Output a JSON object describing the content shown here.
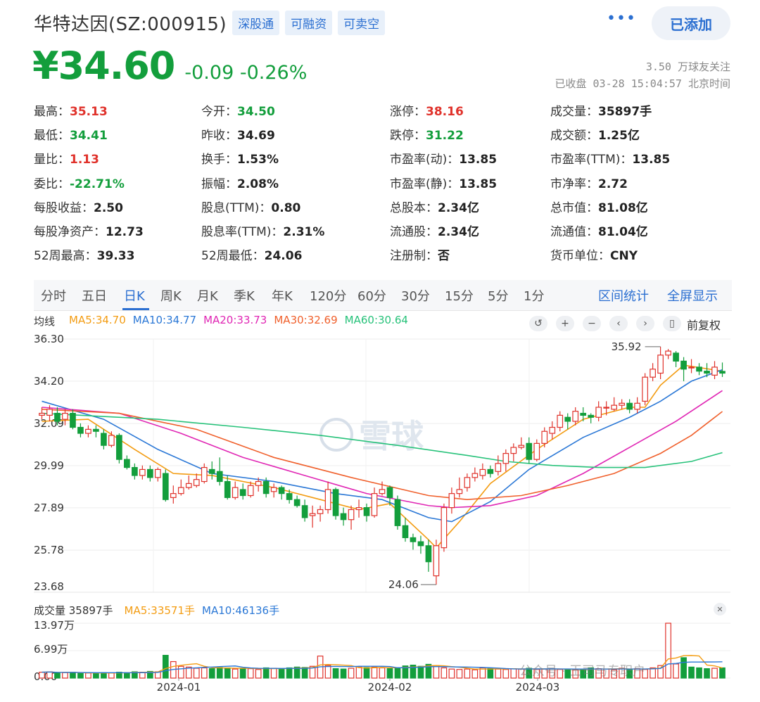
{
  "header": {
    "title": "华特达因(SZ:000915)",
    "tags": [
      "深股通",
      "可融资",
      "可卖空"
    ],
    "more_icon": "more-horizontal-icon",
    "added_label": "已添加"
  },
  "price": {
    "value": "¥34.60",
    "change": "-0.09 -0.26%",
    "followers": "3.50 万球友关注",
    "status": "已收盘 03-28 15:04:57 北京时间"
  },
  "quotes": [
    [
      [
        "最高：",
        "35.13",
        "red"
      ],
      [
        "今开：",
        "34.50",
        "green"
      ],
      [
        "涨停：",
        "38.16",
        "red"
      ],
      [
        "成交量：",
        "35897手",
        ""
      ]
    ],
    [
      [
        "最低：",
        "34.41",
        "green"
      ],
      [
        "昨收：",
        "34.69",
        ""
      ],
      [
        "跌停：",
        "31.22",
        "green"
      ],
      [
        "成交额：",
        "1.25亿",
        ""
      ]
    ],
    [
      [
        "量比：",
        "1.13",
        "red"
      ],
      [
        "换手：",
        "1.53%",
        ""
      ],
      [
        "市盈率(动)：",
        "13.85",
        ""
      ],
      [
        "市盈率(TTM)：",
        "13.85",
        ""
      ]
    ],
    [
      [
        "委比：",
        "-22.71%",
        "green"
      ],
      [
        "振幅：",
        "2.08%",
        ""
      ],
      [
        "市盈率(静)：",
        "13.85",
        ""
      ],
      [
        "市净率：",
        "2.72",
        ""
      ]
    ],
    [
      [
        "每股收益：",
        "2.50",
        ""
      ],
      [
        "股息(TTM)：",
        "0.80",
        ""
      ],
      [
        "总股本：",
        "2.34亿",
        ""
      ],
      [
        "总市值：",
        "81.08亿",
        ""
      ]
    ],
    [
      [
        "每股净资产：",
        "12.73",
        ""
      ],
      [
        "股息率(TTM)：",
        "2.31%",
        ""
      ],
      [
        "流通股：",
        "2.34亿",
        ""
      ],
      [
        "流通值：",
        "81.04亿",
        ""
      ]
    ],
    [
      [
        "52周最高：",
        "39.33",
        ""
      ],
      [
        "52周最低：",
        "24.06",
        ""
      ],
      [
        "注册制：",
        "否",
        ""
      ],
      [
        "货币单位：",
        "CNY",
        ""
      ]
    ]
  ],
  "tabs": [
    "分时",
    "五日",
    "日K",
    "周K",
    "月K",
    "季K",
    "年K",
    "120分",
    "60分",
    "30分",
    "15分",
    "5分",
    "1分"
  ],
  "active_tab": "日K",
  "tab_actions": [
    "区间统计",
    "全屏显示"
  ],
  "ma_legend": {
    "label": "均线",
    "items": [
      {
        "text": "MA5:34.70",
        "color": "#f39c12"
      },
      {
        "text": "MA10:34.77",
        "color": "#2b78d6"
      },
      {
        "text": "MA20:33.73",
        "color": "#e026b4"
      },
      {
        "text": "MA30:32.69",
        "color": "#f0602c"
      },
      {
        "text": "MA60:30.64",
        "color": "#27c27a"
      }
    ]
  },
  "tools": [
    "↺",
    "+",
    "−",
    "‹",
    "›",
    "▯"
  ],
  "tool_icons": [
    "undo-icon",
    "zoom-in-icon",
    "zoom-out-icon",
    "chevron-left-icon",
    "chevron-right-icon",
    "candle-icon"
  ],
  "adjust_label": "前复权",
  "watermark": "雪球",
  "watermark_icon": "snowball-logo-icon",
  "chart_data": {
    "type": "candlestick",
    "y_ticks": [
      "36.30",
      "34.20",
      "32.09",
      "29.99",
      "27.89",
      "25.78",
      "23.68"
    ],
    "ylim": [
      23.68,
      36.3
    ],
    "x_ticks": [
      "2024-01",
      "2024-02",
      "2024-03"
    ],
    "max_label": "35.92",
    "min_label": "24.06",
    "candles": [
      [
        32.5,
        32.6,
        32.9,
        32.3
      ],
      [
        32.5,
        32.8,
        33.0,
        32.2
      ],
      [
        32.6,
        32.2,
        32.9,
        32.0
      ],
      [
        32.3,
        32.6,
        32.8,
        32.0
      ],
      [
        32.6,
        31.9,
        32.8,
        31.8
      ],
      [
        31.9,
        31.6,
        32.1,
        31.4
      ],
      [
        31.6,
        31.8,
        32.0,
        31.4
      ],
      [
        31.8,
        31.7,
        32.0,
        31.4
      ],
      [
        31.6,
        31.0,
        31.8,
        30.8
      ],
      [
        31.0,
        31.5,
        31.7,
        30.9
      ],
      [
        31.5,
        30.3,
        31.6,
        30.1
      ],
      [
        30.3,
        29.9,
        30.5,
        29.8
      ],
      [
        29.9,
        29.5,
        30.1,
        29.3
      ],
      [
        29.5,
        29.8,
        30.0,
        29.3
      ],
      [
        29.8,
        29.4,
        30.0,
        29.2
      ],
      [
        29.4,
        29.8,
        29.9,
        29.2
      ],
      [
        29.6,
        28.3,
        29.8,
        28.2
      ],
      [
        28.4,
        28.6,
        29.0,
        28.1
      ],
      [
        28.6,
        28.9,
        29.3,
        28.5
      ],
      [
        28.9,
        29.1,
        29.5,
        28.8
      ],
      [
        29.0,
        29.3,
        29.6,
        28.9
      ],
      [
        29.2,
        29.9,
        30.1,
        29.1
      ],
      [
        29.8,
        29.6,
        30.2,
        29.3
      ],
      [
        29.7,
        29.2,
        30.4,
        29.0
      ],
      [
        29.2,
        28.4,
        29.5,
        28.3
      ],
      [
        28.4,
        28.9,
        29.2,
        28.3
      ],
      [
        28.8,
        28.5,
        29.1,
        28.3
      ],
      [
        28.5,
        29.0,
        29.2,
        28.4
      ],
      [
        29.0,
        29.2,
        29.4,
        28.7
      ],
      [
        29.2,
        28.6,
        29.4,
        28.4
      ],
      [
        28.7,
        28.9,
        29.1,
        28.4
      ],
      [
        28.9,
        28.6,
        29.0,
        28.3
      ],
      [
        28.6,
        28.3,
        28.8,
        28.1
      ],
      [
        28.3,
        28.0,
        28.5,
        27.9
      ],
      [
        28.0,
        27.4,
        28.3,
        27.2
      ],
      [
        27.5,
        27.6,
        28.0,
        26.9
      ],
      [
        27.6,
        27.8,
        28.0,
        27.2
      ],
      [
        27.8,
        28.8,
        29.2,
        27.6
      ],
      [
        28.8,
        27.5,
        28.9,
        27.3
      ],
      [
        27.6,
        27.3,
        27.9,
        27.0
      ],
      [
        27.3,
        27.8,
        28.0,
        26.8
      ],
      [
        27.8,
        27.9,
        28.3,
        27.4
      ],
      [
        27.9,
        27.5,
        28.1,
        27.2
      ],
      [
        27.5,
        28.6,
        28.9,
        27.4
      ],
      [
        28.6,
        28.8,
        29.2,
        28.5
      ],
      [
        28.9,
        28.4,
        29.0,
        28.0
      ],
      [
        28.3,
        27.0,
        28.5,
        26.8
      ],
      [
        27.0,
        26.4,
        27.4,
        26.2
      ],
      [
        26.4,
        26.2,
        26.6,
        25.8
      ],
      [
        26.2,
        26.0,
        26.5,
        25.6
      ],
      [
        26.0,
        25.2,
        26.3,
        24.7
      ],
      [
        24.5,
        26.0,
        26.3,
        24.06
      ],
      [
        25.9,
        27.9,
        28.1,
        25.7
      ],
      [
        27.9,
        28.6,
        28.9,
        27.6
      ],
      [
        28.6,
        28.8,
        29.4,
        28.4
      ],
      [
        28.9,
        29.4,
        29.6,
        28.7
      ],
      [
        29.4,
        29.6,
        29.9,
        29.2
      ],
      [
        29.5,
        29.8,
        30.1,
        29.3
      ],
      [
        29.8,
        29.6,
        30.0,
        29.4
      ],
      [
        29.7,
        30.1,
        30.5,
        29.5
      ],
      [
        30.1,
        30.6,
        30.8,
        29.7
      ],
      [
        30.6,
        30.9,
        31.1,
        30.2
      ],
      [
        30.9,
        31.0,
        31.4,
        30.8
      ],
      [
        31.1,
        30.3,
        31.4,
        30.1
      ],
      [
        30.3,
        31.1,
        31.3,
        30.2
      ],
      [
        31.1,
        31.7,
        31.9,
        30.9
      ],
      [
        31.6,
        31.9,
        32.2,
        31.3
      ],
      [
        31.9,
        32.5,
        32.7,
        31.7
      ],
      [
        32.4,
        32.2,
        32.6,
        31.8
      ],
      [
        32.2,
        32.7,
        32.9,
        32.0
      ],
      [
        32.6,
        32.5,
        32.9,
        32.2
      ],
      [
        32.5,
        32.4,
        32.6,
        32.1
      ],
      [
        32.4,
        32.9,
        33.2,
        32.2
      ],
      [
        32.9,
        32.9,
        33.2,
        32.5
      ],
      [
        32.8,
        33.0,
        33.4,
        32.7
      ],
      [
        33.0,
        33.1,
        33.3,
        32.8
      ],
      [
        33.1,
        32.8,
        33.3,
        32.6
      ],
      [
        32.8,
        33.1,
        33.4,
        32.6
      ],
      [
        33.2,
        34.4,
        34.6,
        33.0
      ],
      [
        34.4,
        34.8,
        35.1,
        34.2
      ],
      [
        34.6,
        35.5,
        35.92,
        34.3
      ],
      [
        35.5,
        35.7,
        35.8,
        35.3
      ],
      [
        35.6,
        35.2,
        35.7,
        34.9
      ],
      [
        35.2,
        34.8,
        35.4,
        34.2
      ],
      [
        34.9,
        34.9,
        35.3,
        34.6
      ],
      [
        34.9,
        34.7,
        35.1,
        34.5
      ],
      [
        34.7,
        34.6,
        35.1,
        34.4
      ],
      [
        34.5,
        34.9,
        35.2,
        34.3
      ],
      [
        34.69,
        34.6,
        35.13,
        34.41
      ]
    ],
    "ma": {
      "MA5": [
        [
          0,
          32.2
        ],
        [
          6,
          32.3
        ],
        [
          12,
          30.8
        ],
        [
          17,
          29.6
        ],
        [
          22,
          29.5
        ],
        [
          30,
          28.9
        ],
        [
          36,
          28.3
        ],
        [
          41,
          27.8
        ],
        [
          45,
          28.1
        ],
        [
          50,
          26.3
        ],
        [
          51,
          25.9
        ],
        [
          54,
          27.2
        ],
        [
          58,
          29.1
        ],
        [
          64,
          30.8
        ],
        [
          70,
          32.3
        ],
        [
          76,
          32.9
        ],
        [
          78,
          32.9
        ],
        [
          80,
          34.0
        ],
        [
          83,
          35.0
        ],
        [
          88,
          34.7
        ]
      ],
      "MA10": [
        [
          0,
          33.2
        ],
        [
          8,
          32.3
        ],
        [
          15,
          30.8
        ],
        [
          22,
          29.6
        ],
        [
          30,
          29.2
        ],
        [
          38,
          28.6
        ],
        [
          44,
          28.3
        ],
        [
          50,
          27.4
        ],
        [
          53,
          27.2
        ],
        [
          58,
          28.2
        ],
        [
          63,
          29.8
        ],
        [
          70,
          31.4
        ],
        [
          76,
          32.4
        ],
        [
          80,
          33.2
        ],
        [
          84,
          34.2
        ],
        [
          88,
          34.77
        ]
      ],
      "MA20": [
        [
          0,
          32.9
        ],
        [
          10,
          32.6
        ],
        [
          18,
          31.6
        ],
        [
          26,
          30.4
        ],
        [
          34,
          29.5
        ],
        [
          42,
          28.6
        ],
        [
          50,
          28.0
        ],
        [
          53,
          27.9
        ],
        [
          58,
          28.0
        ],
        [
          64,
          28.5
        ],
        [
          70,
          29.6
        ],
        [
          76,
          30.9
        ],
        [
          82,
          32.2
        ],
        [
          88,
          33.73
        ]
      ],
      "MA30": [
        [
          0,
          32.8
        ],
        [
          10,
          32.6
        ],
        [
          20,
          31.8
        ],
        [
          30,
          30.4
        ],
        [
          40,
          29.4
        ],
        [
          50,
          28.5
        ],
        [
          55,
          28.3
        ],
        [
          62,
          28.5
        ],
        [
          68,
          29.0
        ],
        [
          74,
          29.6
        ],
        [
          80,
          30.6
        ],
        [
          84,
          31.5
        ],
        [
          88,
          32.69
        ]
      ],
      "MA60": [
        [
          0,
          32.6
        ],
        [
          15,
          32.3
        ],
        [
          26,
          31.9
        ],
        [
          36,
          31.5
        ],
        [
          46,
          31.0
        ],
        [
          55,
          30.5
        ],
        [
          60,
          30.2
        ],
        [
          66,
          30.0
        ],
        [
          72,
          29.9
        ],
        [
          78,
          29.9
        ],
        [
          84,
          30.2
        ],
        [
          88,
          30.64
        ]
      ]
    }
  },
  "volume": {
    "label": "成交量 35897手",
    "ma5": "MA5:33571手",
    "ma10": "MA10:46136手",
    "ma5_color": "#f39c12",
    "ma10_color": "#2b78d6",
    "close_icon": "close-icon",
    "y_ticks": [
      "13.97万",
      "6.99万",
      "0.00"
    ],
    "values": [
      1.5,
      1.6,
      1.3,
      1.4,
      1.5,
      1.2,
      1.3,
      1.2,
      1.4,
      1.3,
      1.5,
      1.4,
      1.6,
      1.5,
      1.7,
      1.6,
      5.8,
      4.2,
      3.0,
      2.8,
      2.5,
      2.6,
      2.4,
      2.7,
      2.6,
      2.3,
      2.5,
      2.4,
      2.2,
      2.6,
      2.5,
      2.3,
      2.6,
      2.8,
      2.7,
      3.0,
      5.6,
      3.2,
      2.4,
      2.3,
      2.5,
      2.9,
      2.7,
      2.8,
      2.6,
      2.4,
      2.6,
      3.1,
      3.3,
      3.0,
      3.5,
      3.2,
      2.6,
      2.3,
      2.2,
      2.3,
      2.1,
      2.6,
      2.4,
      2.3,
      2.2,
      2.4,
      2.3,
      2.5,
      2.2,
      2.3,
      2.4,
      2.2,
      2.3,
      2.1,
      2.2,
      2.6,
      2.4,
      2.3,
      2.1,
      2.5,
      2.3,
      2.4,
      2.2,
      2.6,
      3.2,
      13.97,
      3.6,
      5.2,
      2.8,
      2.6,
      2.4,
      2.5,
      2.6
    ],
    "ups": [
      1,
      1,
      0,
      1,
      0,
      0,
      1,
      0,
      0,
      1,
      0,
      0,
      0,
      1,
      0,
      1,
      0,
      1,
      1,
      1,
      1,
      1,
      0,
      0,
      0,
      1,
      0,
      1,
      1,
      0,
      1,
      0,
      0,
      0,
      0,
      1,
      1,
      1,
      0,
      0,
      1,
      1,
      0,
      1,
      1,
      0,
      0,
      0,
      0,
      0,
      0,
      1,
      1,
      1,
      1,
      1,
      1,
      1,
      0,
      1,
      1,
      1,
      1,
      0,
      1,
      1,
      1,
      1,
      0,
      1,
      0,
      0,
      1,
      1,
      1,
      1,
      0,
      1,
      1,
      1,
      1,
      1,
      1,
      0,
      0,
      0,
      0,
      1,
      0
    ],
    "x_ticks": [
      "2024-01",
      "2024-02",
      "2024-03"
    ],
    "watermark_text": "公众号 · 王司马专职户"
  }
}
